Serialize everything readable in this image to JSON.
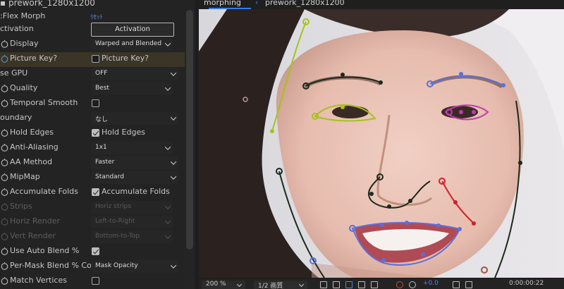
{
  "effect_panel": {
    "header": "▪ prework_1280x1200",
    "effect_name": ":Flex Morph",
    "reset_label": "ﾘｾｯﾄ",
    "rows": [
      {
        "label": "ctivation",
        "button": "Activation"
      },
      {
        "label": "Display",
        "dropdown": "Warped and Blended"
      },
      {
        "label": "Picture Key?",
        "checkbox_label": "Picture Key?",
        "checked": false
      },
      {
        "label": "se GPU",
        "dropdown": "OFF"
      },
      {
        "label": "Quality",
        "dropdown": "Best"
      },
      {
        "label": "Temporal Smooth",
        "checked": false
      },
      {
        "label": "oundary",
        "dropdown": "なし"
      },
      {
        "label": "Hold Edges",
        "checkbox_label": "Hold Edges",
        "checked": true
      },
      {
        "label": "Anti-Aliasing",
        "dropdown": "1x1"
      },
      {
        "label": "AA Method",
        "dropdown": "Faster"
      },
      {
        "label": "MipMap",
        "dropdown": "Standard"
      },
      {
        "label": "Accumulate Folds",
        "checkbox_label": "Accumulate Folds",
        "checked": true
      },
      {
        "label": "Strips",
        "dropdown": "Horiz strips"
      },
      {
        "label": "Horiz Render",
        "dropdown": "Left-to-Right"
      },
      {
        "label": "Vert Render",
        "dropdown": "Bottom-to-Top"
      },
      {
        "label": "Use Auto Blend %",
        "checked": true
      },
      {
        "label": "Per-Mask Blend % Com",
        "dropdown": "Mask Opacity"
      },
      {
        "label": "Match Vertices",
        "checked": false
      }
    ]
  },
  "viewer": {
    "active_tab": "morphing",
    "tab_arrow": "‹",
    "breadcrumb": "prework_1280x1200",
    "zoom": "200 %",
    "resolution": "1/2 画質",
    "exposure": "+0.0",
    "timecode": "0:00:00:22"
  },
  "colors": {
    "accent": "#3b7be6",
    "mask_yellow": "#a7c21b",
    "mask_blue": "#5b6fd8",
    "mask_magenta": "#c23bb0",
    "mask_red": "#d0202a",
    "mask_dark": "#1b2a1b"
  }
}
